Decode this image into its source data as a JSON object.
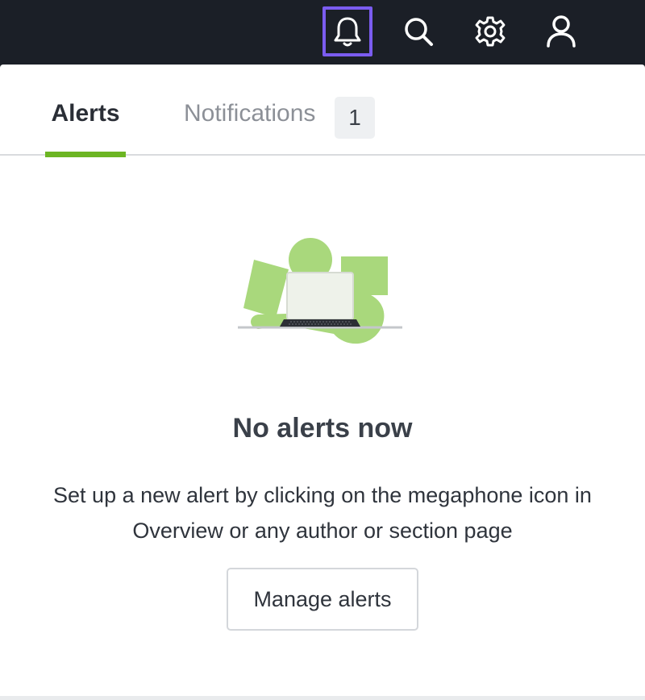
{
  "topbar": {
    "icons": {
      "bell": "bell-icon",
      "search": "search-icon",
      "settings": "gear-icon",
      "user": "user-icon"
    },
    "active_icon": "bell",
    "active_border_color": "#7b5cf0"
  },
  "tabs": {
    "alerts_label": "Alerts",
    "notifications_label": "Notifications",
    "notifications_count": "1",
    "active_tab": "Alerts",
    "active_underline_color": "#6cb523"
  },
  "empty_state": {
    "illustration": "laptop-illustration",
    "title": "No alerts now",
    "description": "Set up a new alert by clicking on the megaphone icon in Overview or any author or section page",
    "button_label": "Manage alerts"
  }
}
